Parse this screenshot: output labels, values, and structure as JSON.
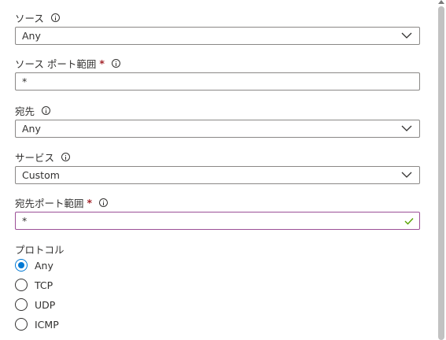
{
  "fields": {
    "source": {
      "label": "ソース",
      "value": "Any"
    },
    "source_port": {
      "label": "ソース ポート範囲",
      "required": "*",
      "value": "*"
    },
    "destination": {
      "label": "宛先",
      "value": "Any"
    },
    "service": {
      "label": "サービス",
      "value": "Custom"
    },
    "dest_port": {
      "label": "宛先ポート範囲",
      "required": "*",
      "value": "*"
    }
  },
  "protocol": {
    "label": "プロトコル",
    "options": [
      "Any",
      "TCP",
      "UDP",
      "ICMP"
    ],
    "selected": "Any"
  },
  "icons": {
    "info": "info-icon",
    "dropdown": "chevron-down-icon",
    "valid": "checkmark-icon"
  },
  "colors": {
    "accent": "#0078d4",
    "required": "#a4262c",
    "focus_border": "#9b4f96",
    "valid": "#57a300"
  }
}
